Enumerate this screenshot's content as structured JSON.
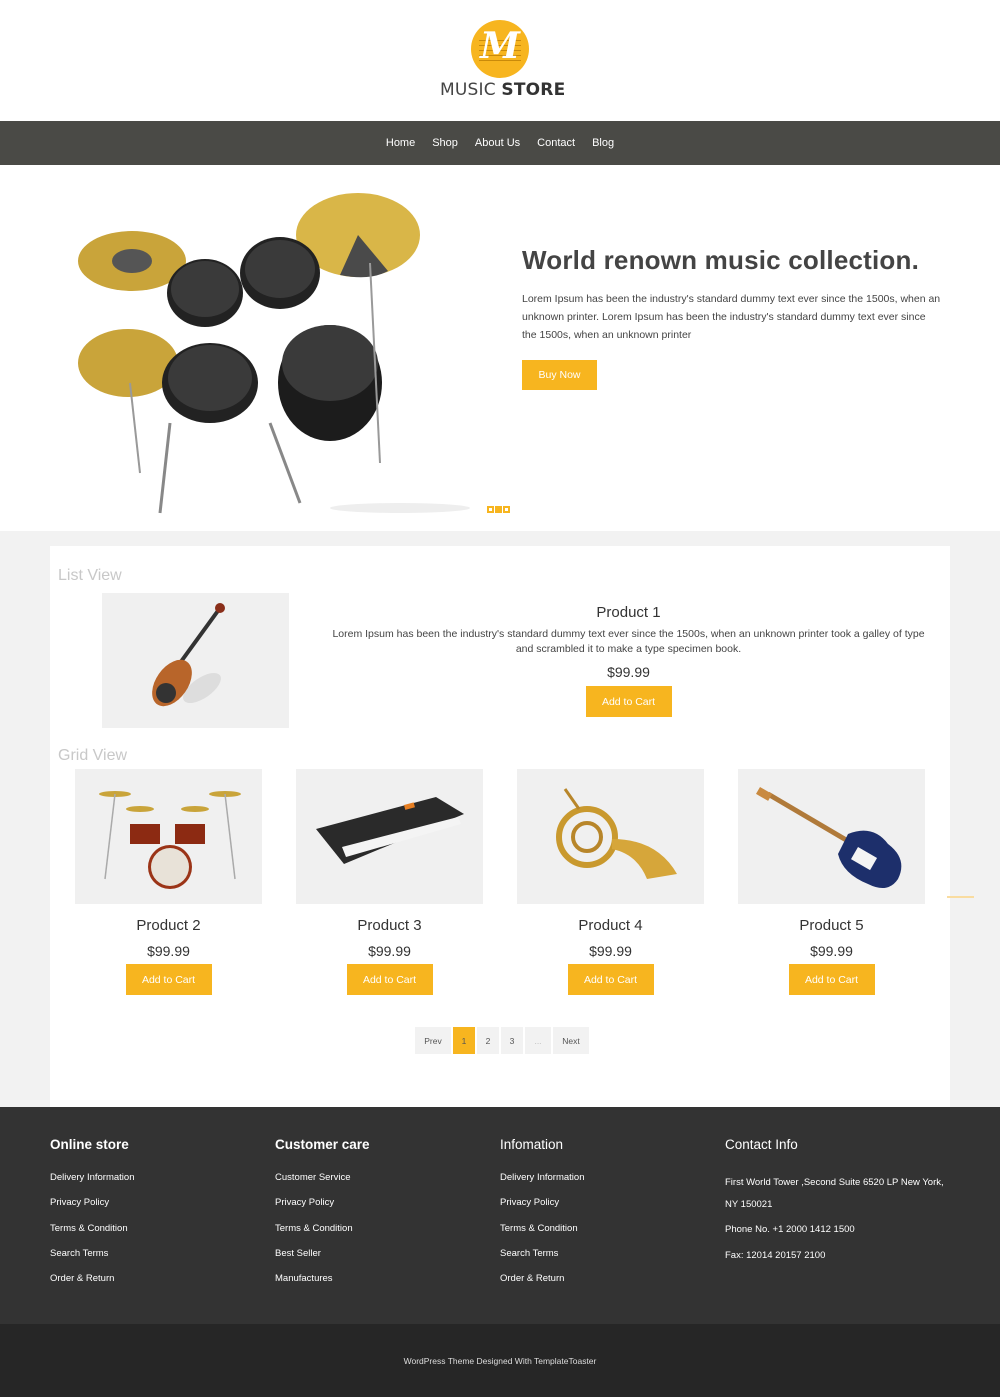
{
  "brand": {
    "logo_letter": "M",
    "name_light": "MUSIC ",
    "name_bold": "STORE",
    "accent_color": "#f7b51f"
  },
  "nav": {
    "items": [
      {
        "label": "Home"
      },
      {
        "label": "Shop"
      },
      {
        "label": "About Us"
      },
      {
        "label": "Contact"
      },
      {
        "label": "Blog"
      }
    ]
  },
  "hero": {
    "image": "drum-kit-image",
    "title": "World renown music collection.",
    "text": "Lorem Ipsum has been the industry's standard dummy text ever since the 1500s, when an unknown printer. Lorem Ipsum has been the industry's standard dummy text ever since the 1500s, when an unknown printer",
    "button_label": "Buy Now",
    "slides": 3,
    "active_slide": 2
  },
  "list_view": {
    "label": "List View",
    "product": {
      "image": "violin-image",
      "name": "Product 1",
      "description": "Lorem Ipsum has been the industry's standard dummy text ever since the 1500s, when an unknown printer took a galley of type and scrambled it to make a type specimen book.",
      "price": "$99.99",
      "button_label": "Add to Cart"
    }
  },
  "grid_view": {
    "label": "Grid View",
    "products": [
      {
        "image": "drum-set-image",
        "name": "Product 2",
        "price": "$99.99",
        "button_label": "Add to Cart"
      },
      {
        "image": "keyboard-image",
        "name": "Product 3",
        "price": "$99.99",
        "button_label": "Add to Cart"
      },
      {
        "image": "french-horn-image",
        "name": "Product 4",
        "price": "$99.99",
        "button_label": "Add to Cart"
      },
      {
        "image": "electric-guitar-image",
        "name": "Product 5",
        "price": "$99.99",
        "button_label": "Add to Cart"
      }
    ]
  },
  "pagination": {
    "prev": "Prev",
    "pages": [
      "1",
      "2",
      "3",
      "..."
    ],
    "active": "1",
    "next": "Next"
  },
  "footer": {
    "columns": [
      {
        "title": "Online store",
        "links": [
          "Delivery Information",
          "Privacy Policy",
          "Terms & Condition",
          "Search Terms",
          "Order & Return"
        ]
      },
      {
        "title": "Customer care",
        "links": [
          "Customer Service",
          "Privacy Policy",
          "Terms & Condition",
          "Best Seller",
          "Manufactures"
        ]
      },
      {
        "title": "Infomation",
        "links": [
          "Delivery Information",
          "Privacy Policy",
          "Terms & Condition",
          "Search Terms",
          "Order & Return"
        ]
      }
    ],
    "contact": {
      "title": "Contact Info",
      "address": "First World Tower ,Second Suite 6520 LP New York, NY 150021",
      "phone": "Phone No. +1 2000 1412 1500",
      "fax": "Fax: 12014 20157 2100"
    },
    "copyright": "WordPress Theme Designed With TemplateToaster"
  }
}
